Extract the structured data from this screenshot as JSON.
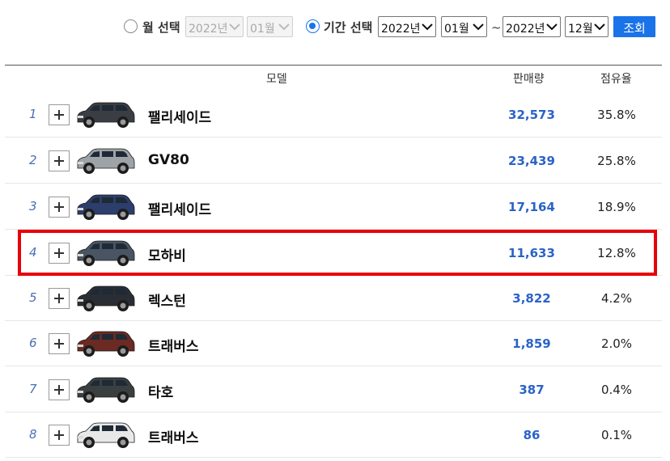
{
  "filter": {
    "month_option_label": "월 선택",
    "month_year_value": "2022년",
    "month_month_value": "01월",
    "period_option_label": "기간 선택",
    "period_start_year": "2022년",
    "period_start_month": "01월",
    "period_separator": "~",
    "period_end_year": "2022년",
    "period_end_month": "12월",
    "search_button_label": "조회",
    "selected_option": "period",
    "accent_color": "#1a73e8"
  },
  "table": {
    "columns": [
      "모델",
      "판매량",
      "점유율"
    ],
    "rows": [
      {
        "rank": "1",
        "model": "팰리세이드",
        "sales": "32,573",
        "share": "35.8%",
        "car_color": "#3b3d44"
      },
      {
        "rank": "2",
        "model": "GV80",
        "sales": "23,439",
        "share": "25.8%",
        "car_color": "#9ea3a8"
      },
      {
        "rank": "3",
        "model": "팰리세이드",
        "sales": "17,164",
        "share": "18.9%",
        "car_color": "#2c3e6b"
      },
      {
        "rank": "4",
        "model": "모하비",
        "sales": "11,633",
        "share": "12.8%",
        "car_color": "#4a5563"
      },
      {
        "rank": "5",
        "model": "렉스턴",
        "sales": "3,822",
        "share": "4.2%",
        "car_color": "#2a2d33"
      },
      {
        "rank": "6",
        "model": "트래버스",
        "sales": "1,859",
        "share": "2.0%",
        "car_color": "#6b2a22"
      },
      {
        "rank": "7",
        "model": "타호",
        "sales": "387",
        "share": "0.4%",
        "car_color": "#3a3f40"
      },
      {
        "rank": "8",
        "model": "트래버스",
        "sales": "86",
        "share": "0.1%",
        "car_color": "#e8e8e8"
      }
    ],
    "highlighted_rank": "4",
    "highlight_color": "#e8000b",
    "sales_color": "#2a63c8"
  }
}
